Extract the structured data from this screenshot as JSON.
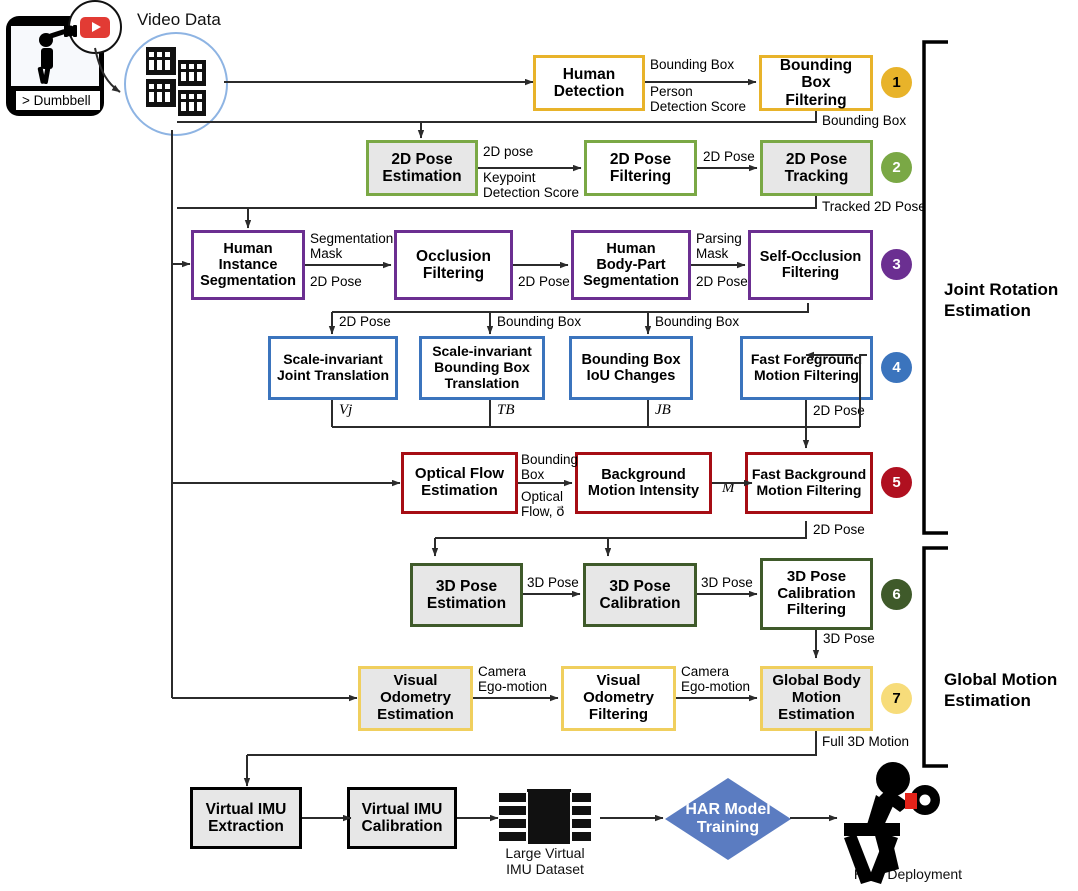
{
  "source": {
    "phone_caption": "> Dumbbell",
    "youtube_icon": "youtube-icon",
    "video_data_label": "Video Data"
  },
  "groups": [
    {
      "id": "joint",
      "label": "Joint Rotation\nEstimation"
    },
    {
      "id": "global",
      "label": "Global Motion\nEstimation"
    }
  ],
  "stages": [
    {
      "num": "1",
      "color": "#e8b32a",
      "text_color": "#000000"
    },
    {
      "num": "2",
      "color": "#7aa845",
      "text_color": "#ffffff"
    },
    {
      "num": "3",
      "color": "#6b2f91",
      "text_color": "#ffffff"
    },
    {
      "num": "4",
      "color": "#3b74bd",
      "text_color": "#ffffff"
    },
    {
      "num": "5",
      "color": "#b01020",
      "text_color": "#ffffff"
    },
    {
      "num": "6",
      "color": "#3f5a2a",
      "text_color": "#ffffff"
    },
    {
      "num": "7",
      "color": "#f7dc7a",
      "text_color": "#000000"
    }
  ],
  "nodes": [
    {
      "id": "human_detection",
      "label": "Human\nDetection",
      "border": "#e8b32a",
      "fill": "#ffffff",
      "fs": 15.5
    },
    {
      "id": "bbox_filtering",
      "label": "Bounding Box\nFiltering",
      "border": "#e8b32a",
      "fill": "#ffffff",
      "fs": 15.5
    },
    {
      "id": "pose2d_estimation",
      "label": "2D Pose\nEstimation",
      "border": "#7aa845",
      "fill": "#e7e7e7",
      "fs": 15.5
    },
    {
      "id": "pose2d_filtering",
      "label": "2D Pose\nFiltering",
      "border": "#7aa845",
      "fill": "#ffffff",
      "fs": 15.5
    },
    {
      "id": "pose2d_tracking",
      "label": "2D Pose\nTracking",
      "border": "#7aa845",
      "fill": "#e7e7e7",
      "fs": 15.5
    },
    {
      "id": "human_instance_segmentation",
      "label": "Human\nInstance\nSegmentation",
      "border": "#6b2f91",
      "fill": "#ffffff",
      "fs": 14.5
    },
    {
      "id": "occlusion_filtering",
      "label": "Occlusion\nFiltering",
      "border": "#6b2f91",
      "fill": "#ffffff",
      "fs": 15.5
    },
    {
      "id": "human_body_part_segmentation",
      "label": "Human\nBody-Part\nSegmentation",
      "border": "#6b2f91",
      "fill": "#ffffff",
      "fs": 14.5
    },
    {
      "id": "self_occlusion_filtering",
      "label": "Self-Occlusion\nFiltering",
      "border": "#6b2f91",
      "fill": "#ffffff",
      "fs": 14.5
    },
    {
      "id": "scale_invariant_joint_translation",
      "label": "Scale-invariant\nJoint Translation",
      "border": "#3b74bd",
      "fill": "#ffffff",
      "fs": 14
    },
    {
      "id": "scale_invariant_bbox_translation",
      "label": "Scale-invariant\nBounding Box\nTranslation",
      "border": "#3b74bd",
      "fill": "#ffffff",
      "fs": 14
    },
    {
      "id": "bbox_iou_changes",
      "label": "Bounding Box\nIoU Changes",
      "border": "#3b74bd",
      "fill": "#ffffff",
      "fs": 14.5
    },
    {
      "id": "fast_foreground_motion_filtering",
      "label": "Fast Foreground\nMotion Filtering",
      "border": "#3b74bd",
      "fill": "#ffffff",
      "fs": 14
    },
    {
      "id": "optical_flow_estimation",
      "label": "Optical Flow\nEstimation",
      "border": "#a60d14",
      "fill": "#ffffff",
      "fs": 15
    },
    {
      "id": "background_motion_intensity",
      "label": "Background\nMotion Intensity",
      "border": "#a60d14",
      "fill": "#ffffff",
      "fs": 14.5
    },
    {
      "id": "fast_background_motion_filtering",
      "label": "Fast Background\nMotion Filtering",
      "border": "#a60d14",
      "fill": "#ffffff",
      "fs": 14
    },
    {
      "id": "pose3d_estimation",
      "label": "3D Pose\nEstimation",
      "border": "#3f5a2a",
      "fill": "#e7e7e7",
      "fs": 15.5
    },
    {
      "id": "pose3d_calibration",
      "label": "3D Pose\nCalibration",
      "border": "#3f5a2a",
      "fill": "#e7e7e7",
      "fs": 15.5
    },
    {
      "id": "pose3d_calibration_filtering",
      "label": "3D Pose\nCalibration\nFiltering",
      "border": "#3f5a2a",
      "fill": "#ffffff",
      "fs": 15
    },
    {
      "id": "visual_odometry_estimation",
      "label": "Visual\nOdometry\nEstimation",
      "border": "#f0cf5e",
      "fill": "#e7e7e7",
      "fs": 15
    },
    {
      "id": "visual_odometry_filtering",
      "label": "Visual\nOdometry\nFiltering",
      "border": "#f0cf5e",
      "fill": "#ffffff",
      "fs": 15
    },
    {
      "id": "global_body_motion_estimation",
      "label": "Global Body\nMotion\nEstimation",
      "border": "#f0cf5e",
      "fill": "#e7e7e7",
      "fs": 15
    },
    {
      "id": "virtual_imu_extraction",
      "label": "Virtual IMU\nExtraction",
      "border": "#000000",
      "fill": "#e7e7e7",
      "fs": 15.5
    },
    {
      "id": "virtual_imu_calibration",
      "label": "Virtual IMU\nCalibration",
      "border": "#000000",
      "fill": "#e7e7e7",
      "fs": 15.5
    }
  ],
  "edge_labels": [
    {
      "id": "bounding_box_1",
      "text": "Bounding Box"
    },
    {
      "id": "person_detection_score",
      "text": "Person\nDetection Score"
    },
    {
      "id": "bounding_box_return",
      "text": "Bounding Box"
    },
    {
      "id": "pose2d_out",
      "text": "2D pose"
    },
    {
      "id": "keypoint_detection_score",
      "text": "Keypoint\nDetection Score"
    },
    {
      "id": "pose2d_mid",
      "text": "2D Pose"
    },
    {
      "id": "tracked_2d_pose",
      "text": "Tracked 2D Pose"
    },
    {
      "id": "segmentation_mask",
      "text": "Segmentation\nMask"
    },
    {
      "id": "pose2d_seg",
      "text": "2D Pose"
    },
    {
      "id": "pose2d_occl",
      "text": "2D Pose"
    },
    {
      "id": "parsing_mask",
      "text": "Parsing\nMask"
    },
    {
      "id": "pose2d_parse",
      "text": "2D Pose"
    },
    {
      "id": "pose2d_r4a",
      "text": "2D Pose"
    },
    {
      "id": "bounding_box_r4b",
      "text": "Bounding Box"
    },
    {
      "id": "bounding_box_r4c",
      "text": "Bounding Box"
    },
    {
      "id": "v_j",
      "text": "Vj"
    },
    {
      "id": "t_b",
      "text": "TB"
    },
    {
      "id": "j_b",
      "text": "JB"
    },
    {
      "id": "pose2d_r4_out",
      "text": "2D Pose"
    },
    {
      "id": "bounding_box_r5",
      "text": "Bounding\nBox"
    },
    {
      "id": "optical_flow_vec",
      "text": "Optical\nFlow, o⃗"
    },
    {
      "id": "m_symbol",
      "text": "M"
    },
    {
      "id": "pose2d_r5_out",
      "text": "2D Pose"
    },
    {
      "id": "pose3d_a",
      "text": "3D Pose"
    },
    {
      "id": "pose3d_b",
      "text": "3D Pose"
    },
    {
      "id": "pose3d_out",
      "text": "3D Pose"
    },
    {
      "id": "camera_ego_motion_a",
      "text": "Camera\nEgo-motion"
    },
    {
      "id": "camera_ego_motion_b",
      "text": "Camera\nEgo-motion"
    },
    {
      "id": "full_3d_motion",
      "text": "Full 3D Motion"
    }
  ],
  "bottom": {
    "dataset_caption": "Large Virtual\nIMU Dataset",
    "har_training": "HAR Model\nTraining",
    "har_deployment": "HAR Deployment"
  }
}
